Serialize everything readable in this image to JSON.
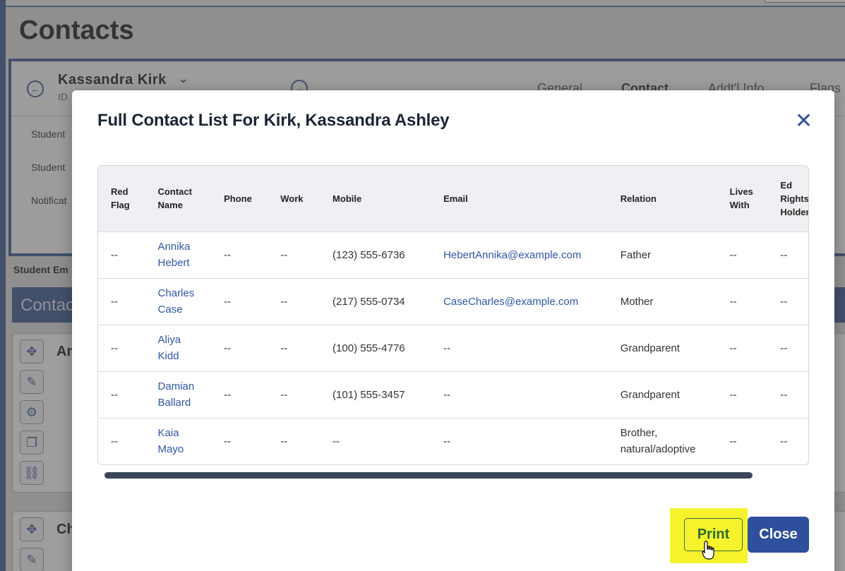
{
  "background": {
    "page_title": "Contacts",
    "student_name": "Kassandra Kirk",
    "student_id_prefix": "ID",
    "tabs": [
      "General",
      "Contact",
      "Addt'l Info",
      "Flags"
    ],
    "rows": [
      "Student",
      "Student",
      "Notificat"
    ],
    "student_email_label": "Student Em",
    "contacts_section": "Contac",
    "contact_card_names": [
      "An",
      "Ch"
    ]
  },
  "modal": {
    "title": "Full Contact List For Kirk, Kassandra Ashley",
    "close_icon": "close-x-icon",
    "columns": [
      {
        "label": "Red Flag",
        "lines": [
          "Red",
          "Flag"
        ]
      },
      {
        "label": "Contact Name",
        "lines": [
          "Contact",
          "Name"
        ]
      },
      {
        "label": "Phone",
        "lines": [
          "Phone"
        ]
      },
      {
        "label": "Work",
        "lines": [
          "Work"
        ]
      },
      {
        "label": "Mobile",
        "lines": [
          "Mobile"
        ]
      },
      {
        "label": "Email",
        "lines": [
          "Email"
        ]
      },
      {
        "label": "Relation",
        "lines": [
          "Relation"
        ]
      },
      {
        "label": "Lives With",
        "lines": [
          "Lives",
          "With"
        ]
      },
      {
        "label": "Ed Rights Holder",
        "lines": [
          "Ed",
          "Rights",
          "Holder"
        ]
      }
    ],
    "rows": [
      {
        "red_flag": "--",
        "name": [
          "Annika",
          "Hebert"
        ],
        "phone": "--",
        "work": "--",
        "mobile": "(123) 555-6736",
        "email": "HebertAnnika@example.com",
        "relation": [
          "Father"
        ],
        "lives_with": "--",
        "ed_rights": "--"
      },
      {
        "red_flag": "--",
        "name": [
          "Charles",
          "Case"
        ],
        "phone": "--",
        "work": "--",
        "mobile": "(217) 555-0734",
        "email": "CaseCharles@example.com",
        "relation": [
          "Mother"
        ],
        "lives_with": "--",
        "ed_rights": "--"
      },
      {
        "red_flag": "--",
        "name": [
          "Aliya",
          "Kidd"
        ],
        "phone": "--",
        "work": "--",
        "mobile": "(100) 555-4776",
        "email": "--",
        "relation": [
          "Grandparent"
        ],
        "lives_with": "--",
        "ed_rights": "--"
      },
      {
        "red_flag": "--",
        "name": [
          "Damian",
          "Ballard"
        ],
        "phone": "--",
        "work": "--",
        "mobile": "(101) 555-3457",
        "email": "--",
        "relation": [
          "Grandparent"
        ],
        "lives_with": "--",
        "ed_rights": "--"
      },
      {
        "red_flag": "--",
        "name": [
          "Kaia",
          "Mayo"
        ],
        "phone": "--",
        "work": "--",
        "mobile": "--",
        "email": "--",
        "relation": [
          "Brother,",
          "natural/adoptive"
        ],
        "lives_with": "--",
        "ed_rights": "--"
      }
    ],
    "buttons": {
      "print": "Print",
      "close": "Close"
    }
  },
  "colors": {
    "accent": "#2e4f9e",
    "highlight": "#f6f32c",
    "link": "#2e57a8"
  }
}
